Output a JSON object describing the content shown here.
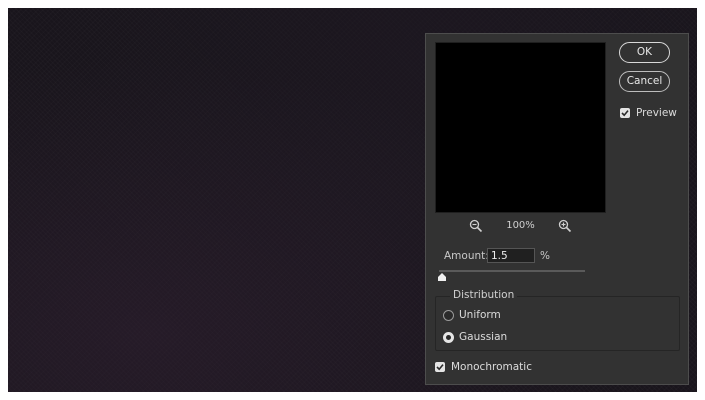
{
  "dialog": {
    "buttons": {
      "ok_label": "OK",
      "cancel_label": "Cancel"
    },
    "preview": {
      "label": "Preview",
      "checked": true
    },
    "zoom": {
      "level": "100%",
      "zoom_out_icon": "zoom-out-icon",
      "zoom_in_icon": "zoom-in-icon"
    },
    "amount": {
      "label": "Amount:",
      "value": "1.5",
      "unit": "%",
      "slider_fraction": 0.0
    },
    "distribution": {
      "title": "Distribution",
      "options": [
        {
          "label": "Uniform",
          "selected": false
        },
        {
          "label": "Gaussian",
          "selected": true
        }
      ]
    },
    "monochromatic": {
      "label": "Monochromatic",
      "checked": true
    }
  },
  "colors": {
    "canvas_background": "#19151c",
    "dialog_background": "#323232",
    "preview_background": "#000000"
  }
}
